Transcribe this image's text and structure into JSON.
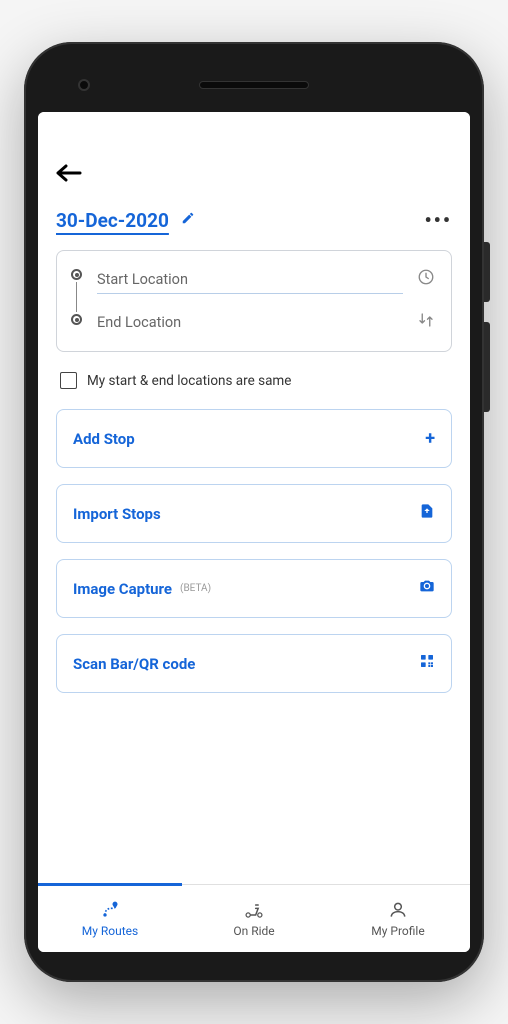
{
  "header": {
    "date": "30-Dec-2020"
  },
  "locations": {
    "start_placeholder": "Start Location",
    "end_placeholder": "End Location",
    "start_value": "",
    "end_value": ""
  },
  "same_location": {
    "label": "My start & end locations are same",
    "checked": false
  },
  "actions": {
    "add_stop": {
      "label": "Add Stop"
    },
    "import_stops": {
      "label": "Import Stops"
    },
    "image_capture": {
      "label": "Image Capture",
      "tag": "(BETA)"
    },
    "scan_code": {
      "label": "Scan Bar/QR code"
    }
  },
  "bottom_nav": {
    "items": [
      {
        "label": "My Routes",
        "active": true
      },
      {
        "label": "On Ride",
        "active": false
      },
      {
        "label": "My Profile",
        "active": false
      }
    ]
  },
  "colors": {
    "primary": "#1565d8",
    "border_light": "#bcd4f0",
    "border_gray": "#d0d4da"
  }
}
